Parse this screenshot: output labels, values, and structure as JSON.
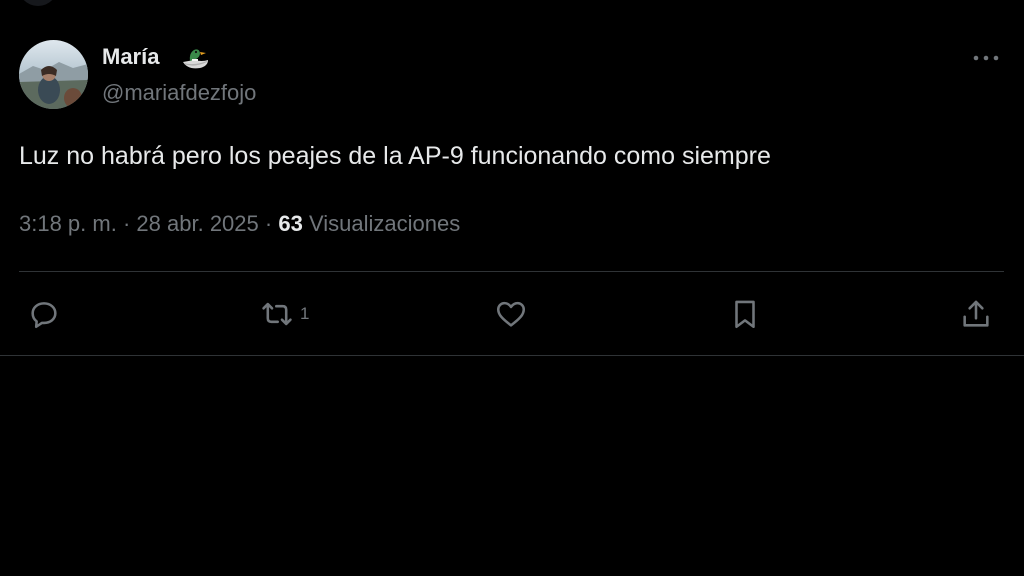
{
  "tweet": {
    "author": {
      "name": "María",
      "name_emoji": "duck-emoji",
      "handle": "@mariafdezfojo"
    },
    "text": "Luz no habrá pero los peajes de la AP-9 funcionando como siempre",
    "time": "3:18 p. m.",
    "separator": "·",
    "date": "28 abr. 2025",
    "views_count": "63",
    "views_label": "Visualizaciones",
    "actions": {
      "reply": {
        "icon": "reply-icon",
        "count": ""
      },
      "retweet": {
        "icon": "retweet-icon",
        "count": "1"
      },
      "like": {
        "icon": "heart-icon",
        "count": ""
      },
      "bookmark": {
        "icon": "bookmark-icon",
        "count": ""
      },
      "share": {
        "icon": "share-icon",
        "count": ""
      }
    },
    "more_icon": "more-dots-icon"
  },
  "colors": {
    "background": "#000000",
    "text_primary": "#e7e9ea",
    "text_secondary": "#71767b",
    "border": "#2f3336"
  }
}
